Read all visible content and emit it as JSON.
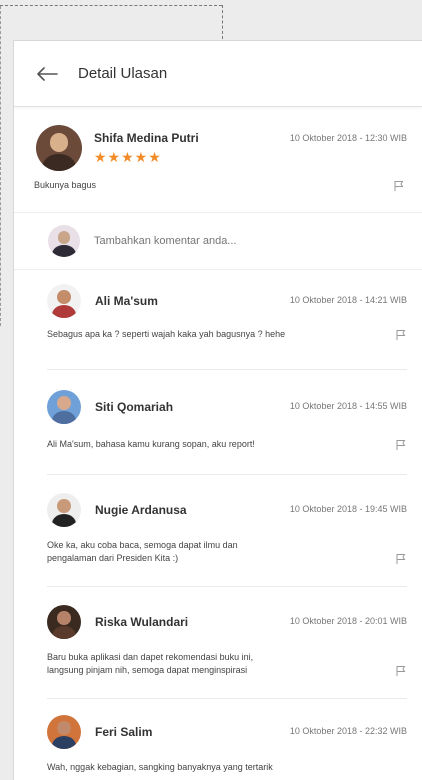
{
  "header": {
    "title": "Detail Ulasan"
  },
  "review": {
    "name": "Shifa Medina Putri",
    "date": "10 Oktober 2018 - 12:30 WIB",
    "rating_stars": "★★★★★",
    "rating": 5,
    "text": "Bukunya bagus"
  },
  "comment_input": {
    "placeholder": "Tambahkan komentar anda..."
  },
  "comments": [
    {
      "name": "Ali Ma'sum",
      "date": "10 Oktober 2018 - 14:21 WIB",
      "lines": [
        "Sebagus apa ka ? seperti wajah kaka yah bagusnya ? hehe"
      ]
    },
    {
      "name": "Siti Qomariah",
      "date": "10 Oktober 2018 - 14:55 WIB",
      "lines": [
        "Ali Ma'sum, bahasa kamu kurang sopan, aku report!"
      ]
    },
    {
      "name": "Nugie Ardanusa",
      "date": "10 Oktober 2018 - 19:45 WIB",
      "lines": [
        "Oke ka, aku coba baca, semoga dapat ilmu dan",
        "pengalaman dari Presiden Kita :)"
      ]
    },
    {
      "name": "Riska Wulandari",
      "date": "10 Oktober 2018 - 20:01 WIB",
      "lines": [
        "Baru buka aplikasi dan dapet rekomendasi buku ini,",
        "langsung pinjam nih, semoga dapat menginspirasi"
      ]
    },
    {
      "name": "Feri Salim",
      "date": "10 Oktober 2018 - 22:32 WIB",
      "lines": [
        "Wah, nggak kebagian, sangking banyaknya yang tertarik"
      ]
    }
  ],
  "colors": {
    "star": "#f28c28",
    "placeholder": "#8fa3c2",
    "accent_text": "#333333"
  },
  "icons": {
    "back": "arrow-left-icon",
    "report": "flag-icon"
  }
}
